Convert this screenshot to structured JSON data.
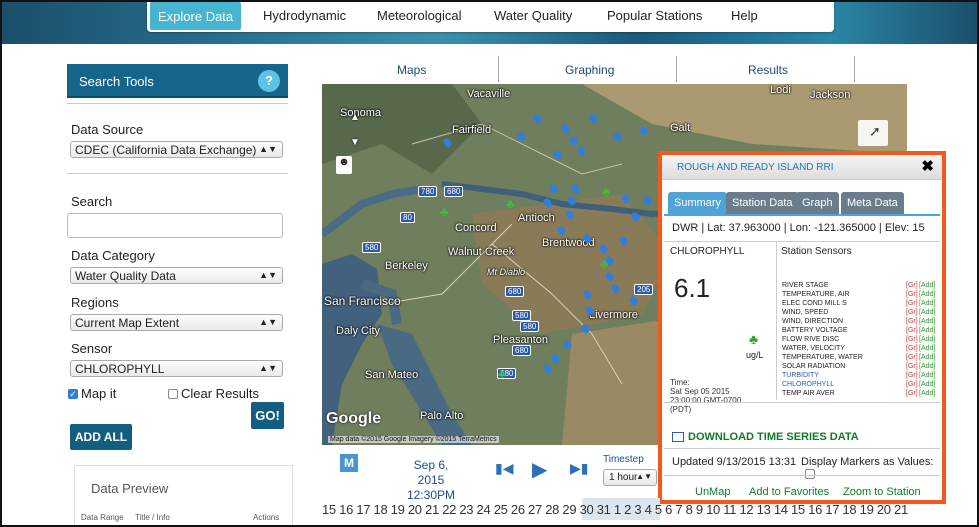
{
  "nav": {
    "items": [
      "Explore Data",
      "Hydrodynamic",
      "Meteorological",
      "Water Quality",
      "Popular Stations",
      "Help"
    ]
  },
  "search_tools": {
    "title": "Search Tools",
    "help": "?",
    "data_source_label": "Data Source",
    "data_source_value": "CDEC (California Data Exchange)",
    "search_label": "Search",
    "search_value": "",
    "data_category_label": "Data Category",
    "data_category_value": "Water Quality Data",
    "regions_label": "Regions",
    "regions_value": "Current Map Extent",
    "sensor_label": "Sensor",
    "sensor_value": "CHLOROPHYLL",
    "map_it_label": "Map it",
    "map_it_checked": true,
    "clear_results_label": "Clear Results",
    "clear_results_checked": false,
    "go_label": "GO!",
    "add_all_label": "ADD ALL"
  },
  "data_preview": {
    "title": "Data Preview",
    "columns": [
      "Data Range",
      "Title / Info",
      "Actions"
    ]
  },
  "map_tabs": [
    "Maps",
    "Graphing",
    "Results"
  ],
  "map": {
    "labels": [
      "Sonoma",
      "Vacaville",
      "Fairfield",
      "Concord",
      "Antioch",
      "Brentwood",
      "Walnut Creek",
      "Berkeley",
      "Mt Diablo",
      "San Francisco",
      "Daly City",
      "Pleasanton",
      "San Mateo",
      "Palo Alto",
      "Lodi",
      "Jackson",
      "Galt",
      "Livermore"
    ],
    "highways": [
      "780",
      "680",
      "80",
      "580",
      "680",
      "580",
      "205",
      "580",
      "680",
      "880"
    ],
    "credit": "Map data ©2015 Google Imagery ©2015 TerraMetrics",
    "google": "Google"
  },
  "popup": {
    "title": "ROUGH AND READY ISLAND RRI",
    "close": "✖",
    "tabs": [
      "Summary",
      "Station Data",
      "Graph",
      "Meta Data"
    ],
    "info": "DWR | Lat: 37.963000 | Lon: -121.365000 | Elev: 15",
    "sensor_name": "CHLOROPHYLL",
    "sensor_value": "6.1",
    "unit": "ug/L",
    "time_lines": [
      "Time:",
      "Sat Sep 05 2015",
      "23:00:00 GMT-0700",
      "(PDT)"
    ],
    "station_sensors_title": "Station Sensors",
    "sensors": [
      {
        "name": "RIVER STAGE",
        "blue": false
      },
      {
        "name": "TEMPERATURE, AIR",
        "blue": false
      },
      {
        "name": "ELEC COND MILL S",
        "blue": false
      },
      {
        "name": "WIND, SPEED",
        "blue": false
      },
      {
        "name": "WIND, DIRECTION",
        "blue": false
      },
      {
        "name": "BATTERY VOLTAGE",
        "blue": false
      },
      {
        "name": "FLOW RIVE DISC",
        "blue": false
      },
      {
        "name": "WATER, VELOCITY",
        "blue": false
      },
      {
        "name": "TEMPERATURE, WATER",
        "blue": false
      },
      {
        "name": "SOLAR RADIATION",
        "blue": false
      },
      {
        "name": "TURBIDITY",
        "blue": true
      },
      {
        "name": "CHLOROPHYLL",
        "blue": true
      },
      {
        "name": "TEMP AIR AVER",
        "blue": false
      }
    ],
    "gr_label": "[Gr]",
    "add_label": "[Add]",
    "download_label": "DOWNLOAD TIME SERIES DATA",
    "updated": "Updated 9/13/2015 13:31",
    "markers_label": "Display Markers as Values:",
    "links": [
      "UnMap",
      "Add to Favorites",
      "Zoom to Station"
    ]
  },
  "timeline": {
    "m_label": "M",
    "date_line1": "Sep 6, 2015",
    "date_line2": "12:30PM",
    "timestep_label": "Timestep",
    "timestep_value": "1 hour",
    "days": "15 16 17 18 19 20 21 22 23 24 25 26 27 28 29 30 31  1  2  3  4  5  6  7  8  9  10 11 12 13 14 15 16 17 18 19 20 21"
  },
  "colors": {
    "accent": "#46b5d1",
    "panel_header": "#15668a",
    "popup_border": "#f25a1d",
    "link_green": "#107a28"
  }
}
